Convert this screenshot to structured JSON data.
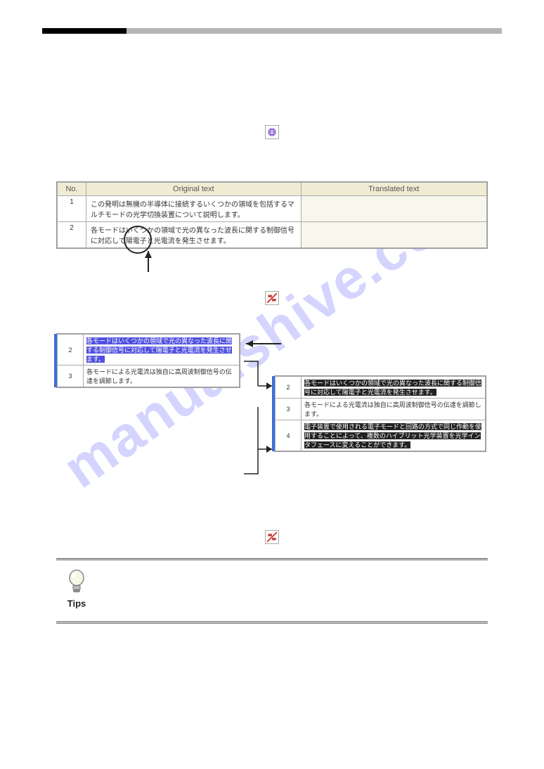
{
  "watermark": "manualshive.com",
  "table1": {
    "headers": {
      "no": "No.",
      "original": "Original text",
      "translated": "Translated text"
    },
    "rows": [
      {
        "no": "1",
        "orig": "この発明は無機の半導体に接続するいくつかの領域を包括するマルチモードの光学切換装置について説明します。",
        "trans": ""
      },
      {
        "no": "2",
        "orig": "各モードはいくつかの領域で光の異なった波長に関する制御信号に対応して陽電子と光電流を発生させます。",
        "trans": ""
      }
    ]
  },
  "lower_left": {
    "rows": [
      {
        "no": "2",
        "text": "各モードはいくつかの領域で光の異なった波長に関する制御信号に対応して陽電子と光電流を発生させます。"
      },
      {
        "no": "3",
        "text": "各モードによる光電流は独自に高周波制御信号の伝達を調節します。"
      }
    ]
  },
  "lower_right": {
    "rows": [
      {
        "no": "2",
        "text": "各モードはいくつかの領域で光の異なった波長に関する制御信号に対応して陽電子と光電流を発生させます。"
      },
      {
        "no": "3",
        "text": "各モードによる光電流は独自に高周波制御信号の伝達を調節します。"
      },
      {
        "no": "4",
        "text": "電子装置で使用される電子モードと回路の方式で同じ作動を使用することによって、複数のハイブリット光学装置を光学インタフェースに変えることができます。"
      }
    ]
  },
  "tips": {
    "label": "Tips"
  }
}
